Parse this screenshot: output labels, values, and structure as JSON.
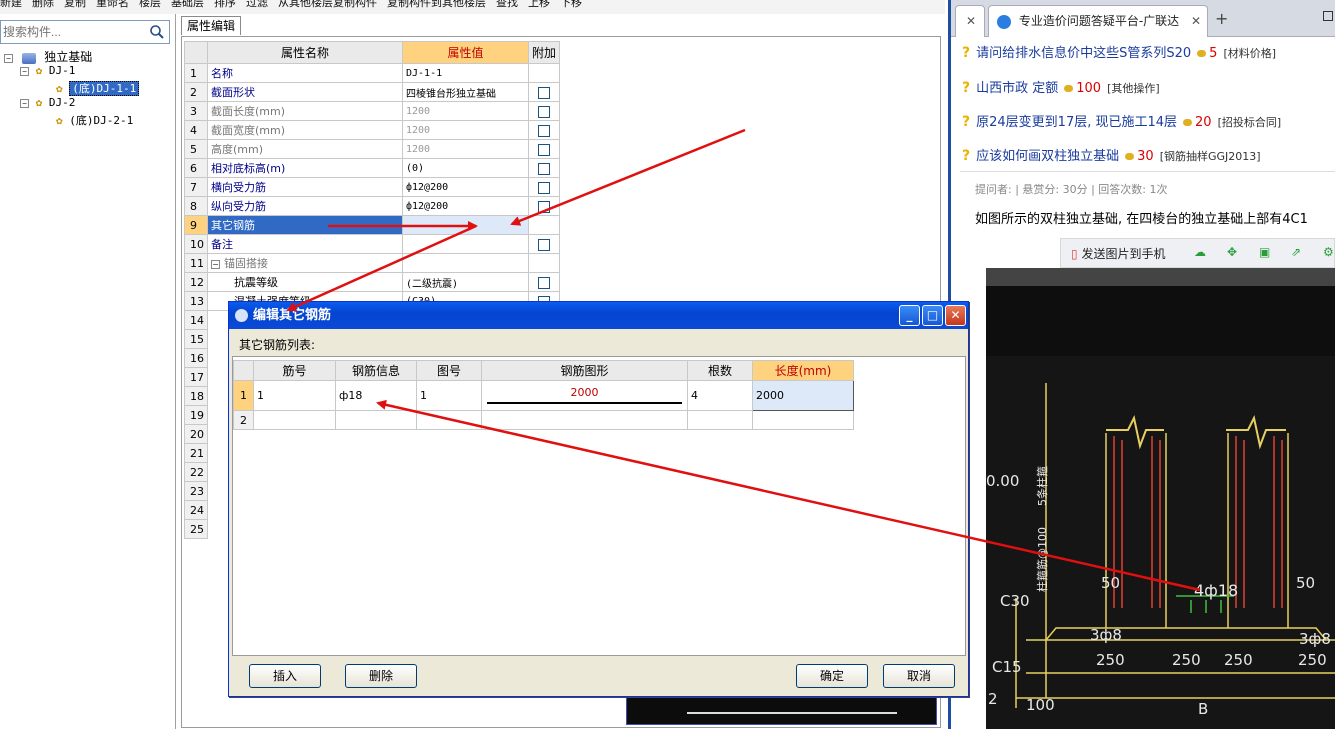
{
  "toolbar": {
    "items": [
      "新建",
      "删除",
      "复制",
      "重命名",
      "楼层",
      "基础层",
      "排序",
      "过滤",
      "从其他楼层复制构件",
      "复制构件到其他楼层",
      "查找",
      "上移",
      "下移"
    ]
  },
  "left_panel": {
    "search_placeholder": "搜索构件...",
    "tree": {
      "root": "独立基础",
      "groups": [
        {
          "label": "DJ-1",
          "children": [
            "(底)DJ-1-1"
          ]
        },
        {
          "label": "DJ-2",
          "children": [
            "(底)DJ-2-1"
          ]
        }
      ]
    }
  },
  "property_editor": {
    "tab_label": "属性编辑",
    "headers": {
      "name": "属性名称",
      "value": "属性值",
      "extra": "附加"
    },
    "rows": [
      {
        "n": "1",
        "name": "名称",
        "value": "DJ-1-1"
      },
      {
        "n": "2",
        "name": "截面形状",
        "value": "四棱锥台形独立基础"
      },
      {
        "n": "3",
        "name": "截面长度(mm)",
        "value": "1200"
      },
      {
        "n": "4",
        "name": "截面宽度(mm)",
        "value": "1200"
      },
      {
        "n": "5",
        "name": "高度(mm)",
        "value": "1200"
      },
      {
        "n": "6",
        "name": "相对底标高(m)",
        "value": "(0)"
      },
      {
        "n": "7",
        "name": "横向受力筋",
        "value": "ф12@200"
      },
      {
        "n": "8",
        "name": "纵向受力筋",
        "value": "ф12@200"
      },
      {
        "n": "9",
        "name": "其它钢筋",
        "value": ""
      },
      {
        "n": "10",
        "name": "备注",
        "value": ""
      },
      {
        "n": "11",
        "name": "锚固搭接",
        "value": ""
      },
      {
        "n": "12",
        "name": "抗震等级",
        "value": "(二级抗震)"
      },
      {
        "n": "13",
        "name": "混凝土强度等级",
        "value": "(C30)"
      }
    ],
    "extra_rows": [
      "14",
      "15",
      "16",
      "17",
      "18",
      "19",
      "20",
      "21",
      "22",
      "23",
      "24",
      "25"
    ]
  },
  "dialog": {
    "title": "编辑其它钢筋",
    "list_label": "其它钢筋列表:",
    "headers": [
      "筋号",
      "钢筋信息",
      "图号",
      "钢筋图形",
      "根数",
      "长度(mm)"
    ],
    "rows": [
      {
        "n": "1",
        "bar_no": "1",
        "info": "ф18",
        "fig_no": "1",
        "shape_value": "2000",
        "count": "4",
        "length": "2000"
      },
      {
        "n": "2",
        "bar_no": "",
        "info": "",
        "fig_no": "",
        "shape_value": "",
        "count": "",
        "length": ""
      }
    ],
    "buttons": {
      "insert": "插入",
      "delete": "删除",
      "ok": "确定",
      "cancel": "取消"
    }
  },
  "browser": {
    "tab_title": "专业造价问题答疑平台-广联达",
    "questions": [
      {
        "title": "请问给排水信息价中这些S管系列S20",
        "points": "5",
        "category": "[材料价格]"
      },
      {
        "title": "山西市政 定额",
        "points": "100",
        "category": "[其他操作]"
      },
      {
        "title": "原24层变更到17层, 现已施工14层",
        "points": "20",
        "category": "[招投标合同]"
      },
      {
        "title": "应该如何画双柱独立基础",
        "points": "30",
        "category": "[钢筋抽样GGJ2013]"
      }
    ],
    "meta": "提问者:    |  悬赏分: 30分    |  回答次数: 1次",
    "body_text": "如图所示的双柱独立基础, 在四棱台的独立基础上部有4C1",
    "image_toolbar": {
      "send_label": "发送图片到手机"
    },
    "photo_labels": [
      "0.00",
      "5条柱箍",
      "柱箍筋@100",
      "50",
      "50",
      "4ф18",
      "C30",
      "3ф8",
      "3ф8",
      "250",
      "250",
      "250",
      "250",
      "C15",
      "100",
      "B",
      "2"
    ]
  },
  "colors": {
    "arrow": "#e01010",
    "accent": "#0a4ad6",
    "header_value": "#ffd27f"
  }
}
